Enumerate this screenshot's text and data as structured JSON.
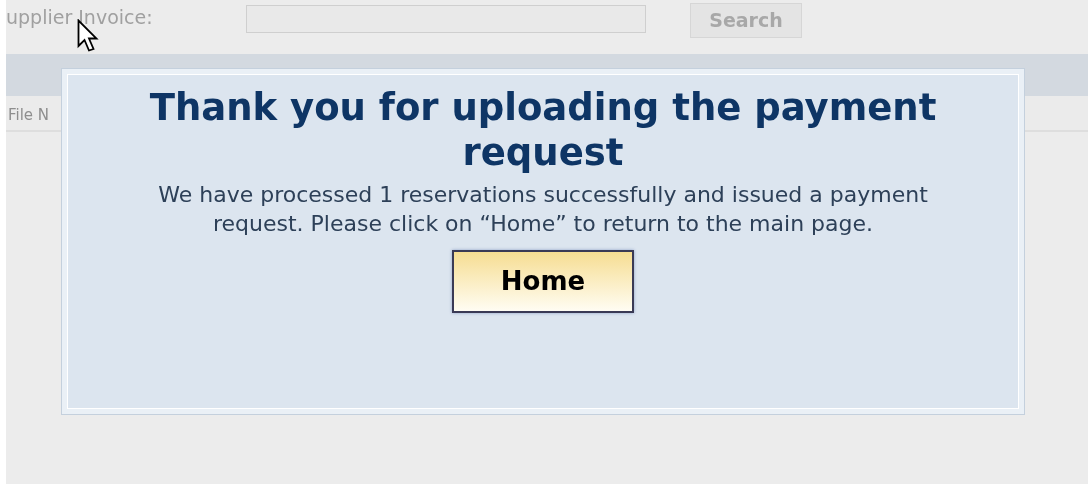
{
  "search_bar": {
    "label": "upplier Invoice:",
    "search_button": "Search"
  },
  "table": {
    "column_1": "File N"
  },
  "dialog": {
    "title": "Thank you for uploading the payment request",
    "message": "We have processed 1 reservations successfully and issued a payment request. Please click on “Home” to return to the main page.",
    "button": "Home"
  }
}
